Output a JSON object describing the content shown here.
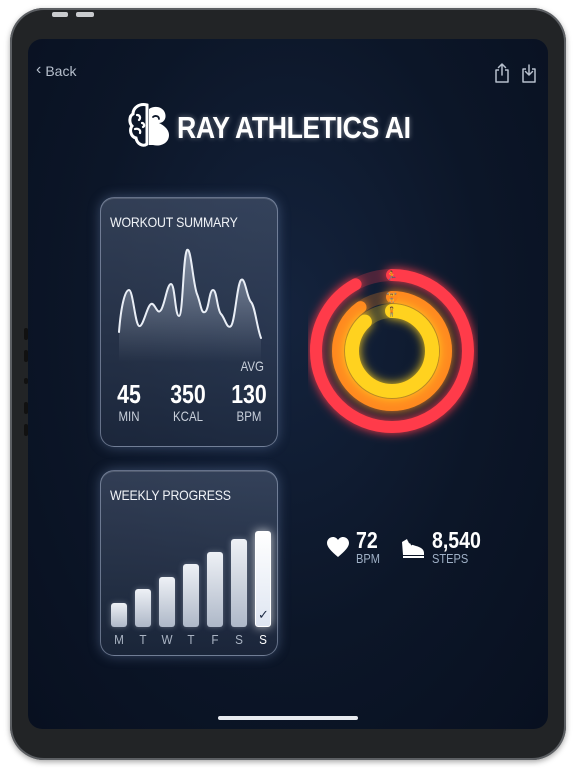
{
  "nav": {
    "back_label": "Back",
    "share_icon": "share-icon",
    "download_icon": "download-icon"
  },
  "brand": {
    "title": "RAY ATHLETICS AI",
    "logo_icon": "brain-muscle-icon"
  },
  "workout_summary": {
    "title": "WORKOUT SUMMARY",
    "avg_label": "AVG",
    "stats": [
      {
        "value": "45",
        "unit": "MIN"
      },
      {
        "value": "350",
        "unit": "KCAL"
      },
      {
        "value": "130",
        "unit": "BPM"
      }
    ]
  },
  "weekly_progress": {
    "title": "WEEKLY PROGRESS",
    "days": [
      "M",
      "T",
      "W",
      "T",
      "F",
      "S",
      "S"
    ],
    "values": [
      0.25,
      0.4,
      0.52,
      0.66,
      0.78,
      0.92,
      1.0
    ],
    "active_index": 6,
    "check_icon": "checkmark-icon"
  },
  "activity_rings": {
    "rings": [
      {
        "name": "move",
        "icon": "running-figure-icon",
        "color": "#ff3b4a",
        "progress": 0.92
      },
      {
        "name": "exercise",
        "icon": "weightlifting-icon",
        "color": "#ff8a1f",
        "progress": 0.9
      },
      {
        "name": "stand",
        "icon": "standing-figure-icon",
        "color": "#ffd21f",
        "progress": 0.88
      }
    ]
  },
  "metrics": {
    "heart": {
      "value": "72",
      "unit": "BPM",
      "icon": "heart-icon"
    },
    "steps": {
      "value": "8,540",
      "unit": "STEPS",
      "icon": "sneaker-icon"
    }
  }
}
